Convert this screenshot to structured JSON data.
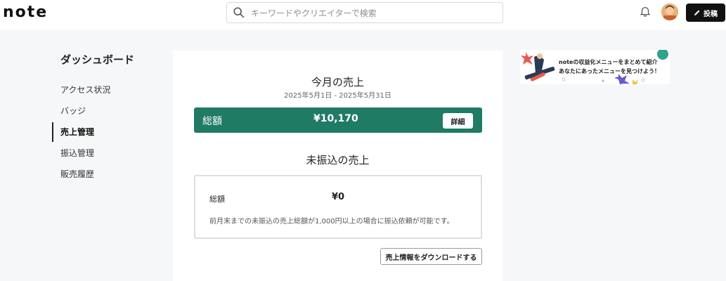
{
  "header": {
    "logo": "note",
    "search_placeholder": "キーワードやクリエイターで検索",
    "post_label": "投稿"
  },
  "sidebar": {
    "title": "ダッシュボード",
    "items": [
      {
        "label": "アクセス状況"
      },
      {
        "label": "バッジ"
      },
      {
        "label": "売上管理",
        "active": true
      },
      {
        "label": "振込管理"
      },
      {
        "label": "販売履歴"
      }
    ]
  },
  "main": {
    "month_title": "今月の売上",
    "month_range": "2025年5月1日 - 2025年5月31日",
    "total_label": "総額",
    "total_amount": "¥10,170",
    "detail_button": "詳細",
    "unpaid_title": "未振込の売上",
    "unpaid_label": "総額",
    "unpaid_amount": "¥0",
    "unpaid_note": "前月末までの未振込の売上総額が1,000円以上の場合に振込依頼が可能です。",
    "download_button": "売上情報をダウンロードする"
  },
  "banner": {
    "line1": "noteの収益化メニューをまとめて紹介",
    "line2": "あなたにあったメニューを見つけよう！"
  },
  "colors": {
    "accent_green": "#1f7b64"
  }
}
